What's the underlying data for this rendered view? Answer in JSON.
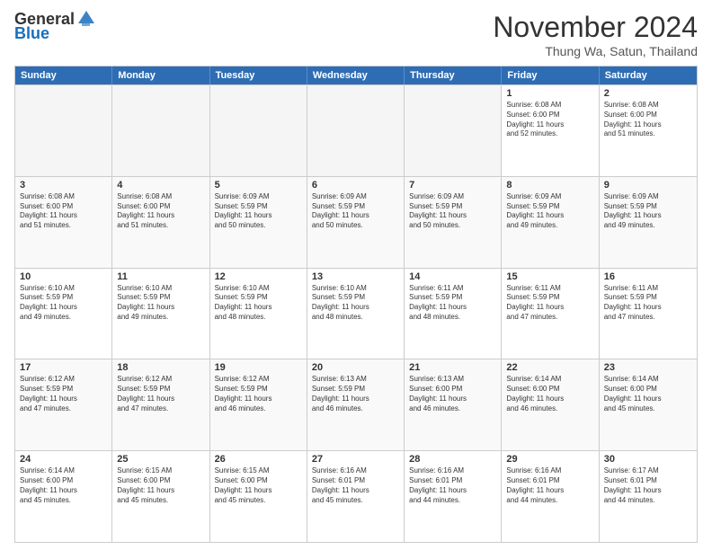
{
  "header": {
    "logo_general": "General",
    "logo_blue": "Blue",
    "month_title": "November 2024",
    "location": "Thung Wa, Satun, Thailand"
  },
  "days_of_week": [
    "Sunday",
    "Monday",
    "Tuesday",
    "Wednesday",
    "Thursday",
    "Friday",
    "Saturday"
  ],
  "rows": [
    [
      {
        "day": "",
        "text": "",
        "empty": true
      },
      {
        "day": "",
        "text": "",
        "empty": true
      },
      {
        "day": "",
        "text": "",
        "empty": true
      },
      {
        "day": "",
        "text": "",
        "empty": true
      },
      {
        "day": "",
        "text": "",
        "empty": true
      },
      {
        "day": "1",
        "text": "Sunrise: 6:08 AM\nSunset: 6:00 PM\nDaylight: 11 hours\nand 52 minutes.",
        "empty": false
      },
      {
        "day": "2",
        "text": "Sunrise: 6:08 AM\nSunset: 6:00 PM\nDaylight: 11 hours\nand 51 minutes.",
        "empty": false
      }
    ],
    [
      {
        "day": "3",
        "text": "Sunrise: 6:08 AM\nSunset: 6:00 PM\nDaylight: 11 hours\nand 51 minutes.",
        "empty": false
      },
      {
        "day": "4",
        "text": "Sunrise: 6:08 AM\nSunset: 6:00 PM\nDaylight: 11 hours\nand 51 minutes.",
        "empty": false
      },
      {
        "day": "5",
        "text": "Sunrise: 6:09 AM\nSunset: 5:59 PM\nDaylight: 11 hours\nand 50 minutes.",
        "empty": false
      },
      {
        "day": "6",
        "text": "Sunrise: 6:09 AM\nSunset: 5:59 PM\nDaylight: 11 hours\nand 50 minutes.",
        "empty": false
      },
      {
        "day": "7",
        "text": "Sunrise: 6:09 AM\nSunset: 5:59 PM\nDaylight: 11 hours\nand 50 minutes.",
        "empty": false
      },
      {
        "day": "8",
        "text": "Sunrise: 6:09 AM\nSunset: 5:59 PM\nDaylight: 11 hours\nand 49 minutes.",
        "empty": false
      },
      {
        "day": "9",
        "text": "Sunrise: 6:09 AM\nSunset: 5:59 PM\nDaylight: 11 hours\nand 49 minutes.",
        "empty": false
      }
    ],
    [
      {
        "day": "10",
        "text": "Sunrise: 6:10 AM\nSunset: 5:59 PM\nDaylight: 11 hours\nand 49 minutes.",
        "empty": false
      },
      {
        "day": "11",
        "text": "Sunrise: 6:10 AM\nSunset: 5:59 PM\nDaylight: 11 hours\nand 49 minutes.",
        "empty": false
      },
      {
        "day": "12",
        "text": "Sunrise: 6:10 AM\nSunset: 5:59 PM\nDaylight: 11 hours\nand 48 minutes.",
        "empty": false
      },
      {
        "day": "13",
        "text": "Sunrise: 6:10 AM\nSunset: 5:59 PM\nDaylight: 11 hours\nand 48 minutes.",
        "empty": false
      },
      {
        "day": "14",
        "text": "Sunrise: 6:11 AM\nSunset: 5:59 PM\nDaylight: 11 hours\nand 48 minutes.",
        "empty": false
      },
      {
        "day": "15",
        "text": "Sunrise: 6:11 AM\nSunset: 5:59 PM\nDaylight: 11 hours\nand 47 minutes.",
        "empty": false
      },
      {
        "day": "16",
        "text": "Sunrise: 6:11 AM\nSunset: 5:59 PM\nDaylight: 11 hours\nand 47 minutes.",
        "empty": false
      }
    ],
    [
      {
        "day": "17",
        "text": "Sunrise: 6:12 AM\nSunset: 5:59 PM\nDaylight: 11 hours\nand 47 minutes.",
        "empty": false
      },
      {
        "day": "18",
        "text": "Sunrise: 6:12 AM\nSunset: 5:59 PM\nDaylight: 11 hours\nand 47 minutes.",
        "empty": false
      },
      {
        "day": "19",
        "text": "Sunrise: 6:12 AM\nSunset: 5:59 PM\nDaylight: 11 hours\nand 46 minutes.",
        "empty": false
      },
      {
        "day": "20",
        "text": "Sunrise: 6:13 AM\nSunset: 5:59 PM\nDaylight: 11 hours\nand 46 minutes.",
        "empty": false
      },
      {
        "day": "21",
        "text": "Sunrise: 6:13 AM\nSunset: 6:00 PM\nDaylight: 11 hours\nand 46 minutes.",
        "empty": false
      },
      {
        "day": "22",
        "text": "Sunrise: 6:14 AM\nSunset: 6:00 PM\nDaylight: 11 hours\nand 46 minutes.",
        "empty": false
      },
      {
        "day": "23",
        "text": "Sunrise: 6:14 AM\nSunset: 6:00 PM\nDaylight: 11 hours\nand 45 minutes.",
        "empty": false
      }
    ],
    [
      {
        "day": "24",
        "text": "Sunrise: 6:14 AM\nSunset: 6:00 PM\nDaylight: 11 hours\nand 45 minutes.",
        "empty": false
      },
      {
        "day": "25",
        "text": "Sunrise: 6:15 AM\nSunset: 6:00 PM\nDaylight: 11 hours\nand 45 minutes.",
        "empty": false
      },
      {
        "day": "26",
        "text": "Sunrise: 6:15 AM\nSunset: 6:00 PM\nDaylight: 11 hours\nand 45 minutes.",
        "empty": false
      },
      {
        "day": "27",
        "text": "Sunrise: 6:16 AM\nSunset: 6:01 PM\nDaylight: 11 hours\nand 45 minutes.",
        "empty": false
      },
      {
        "day": "28",
        "text": "Sunrise: 6:16 AM\nSunset: 6:01 PM\nDaylight: 11 hours\nand 44 minutes.",
        "empty": false
      },
      {
        "day": "29",
        "text": "Sunrise: 6:16 AM\nSunset: 6:01 PM\nDaylight: 11 hours\nand 44 minutes.",
        "empty": false
      },
      {
        "day": "30",
        "text": "Sunrise: 6:17 AM\nSunset: 6:01 PM\nDaylight: 11 hours\nand 44 minutes.",
        "empty": false
      }
    ]
  ]
}
